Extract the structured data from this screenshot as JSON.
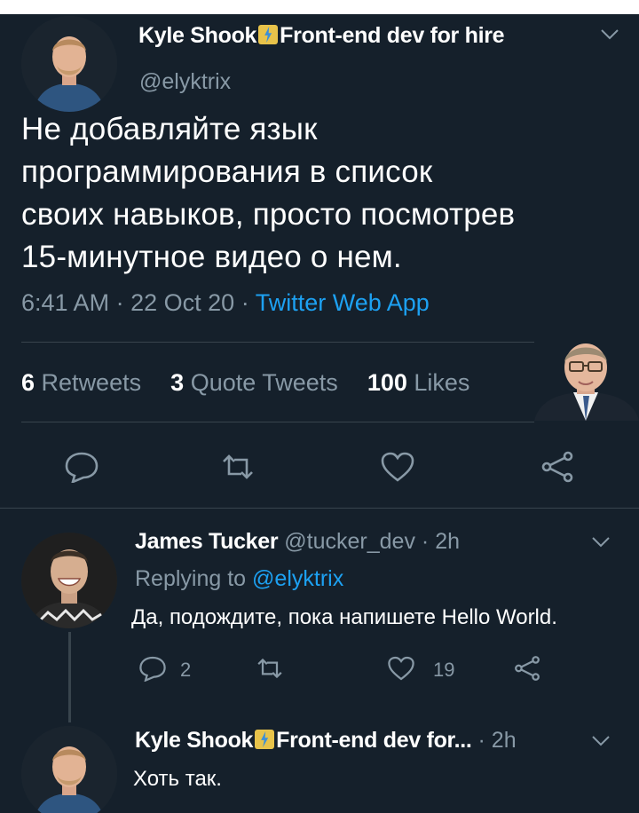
{
  "main_tweet": {
    "author_name": "Kyle Shook",
    "author_bio_tag": "Front-end dev for hire",
    "handle": "@elyktrix",
    "text_lines": [
      "Не добавляйте язык",
      "программирования в список",
      "своих навыков, просто посмотрев",
      "15-минутное видео о нем."
    ],
    "time": "6:41 AM",
    "date": "22 Oct 20",
    "source": "Twitter Web App",
    "sep": "·",
    "stats": {
      "retweets_count": "6",
      "retweets_label": "Retweets",
      "quotes_count": "3",
      "quotes_label": "Quote Tweets",
      "likes_count": "100",
      "likes_label": "Likes"
    }
  },
  "reply_1": {
    "author_name": "James Tucker",
    "handle": "@tucker_dev",
    "age": "2h",
    "replying_prefix": "Replying to",
    "replying_handle": "@elyktrix",
    "text": "Да, подождите, пока напишете Hello World.",
    "reply_count": "2",
    "like_count": "19"
  },
  "reply_2": {
    "author_name": "Kyle Shook",
    "author_bio_tag_truncated": "Front-end dev for...",
    "age": "2h",
    "text": "Хоть так."
  },
  "icons": [
    "reply-icon",
    "retweet-icon",
    "like-icon",
    "share-icon",
    "chevron-down-icon"
  ],
  "colors": {
    "background": "#15202b",
    "text": "#ffffff",
    "secondary": "#8899a6",
    "link": "#1da1f2",
    "divider": "#38444d"
  }
}
